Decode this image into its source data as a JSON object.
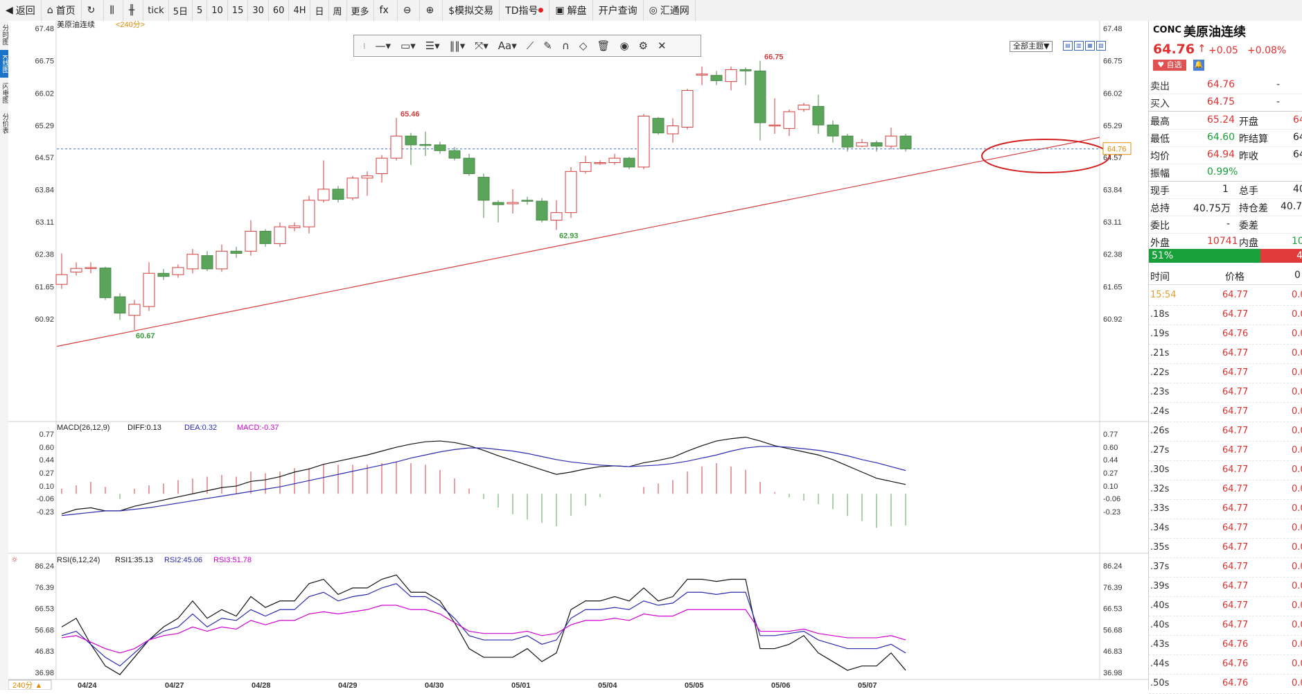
{
  "toolbar": {
    "items": [
      "返回",
      "首页",
      "",
      "",
      "",
      "tick",
      "5日",
      "5",
      "10",
      "15",
      "30",
      "60",
      "4H",
      "日",
      "周",
      "更多",
      "",
      "",
      "",
      "$模拟交易",
      "TD指号",
      "解盘",
      "开户查询",
      "汇通网"
    ]
  },
  "left_tabs": [
    "分时图",
    "K线图",
    "闪电图",
    "分价表"
  ],
  "chart": {
    "title": "美原油连续",
    "period": "<240分>",
    "theme_label": "全部主题▼",
    "period_button": "240分 ▲",
    "price_ticks": [
      "67.48",
      "66.75",
      "66.02",
      "65.29",
      "64.57",
      "63.84",
      "63.11",
      "62.38",
      "61.65",
      "60.92"
    ],
    "current_price_label": "64.76",
    "high_label": "66.75",
    "mid_high_label": "65.46",
    "low_label": "60.67",
    "mid_low_label": "62.93",
    "x_labels": [
      "04/24",
      "04/27",
      "04/28",
      "04/29",
      "04/30",
      "05/01",
      "05/04",
      "05/05",
      "05/06",
      "05/07"
    ],
    "macd": {
      "title": "MACD(26,12,9)",
      "diff": "DIFF:0.13",
      "dea": "DEA:0.32",
      "macd": "MACD:-0.37",
      "ticks": [
        "0.77",
        "0.60",
        "0.44",
        "0.27",
        "0.10",
        "-0.06",
        "-0.23"
      ]
    },
    "rsi": {
      "title": "RSI(6,12,24)",
      "rsi1": "RSI1:35.13",
      "rsi2": "RSI2:45.06",
      "rsi3": "RSI3:51.78",
      "ticks": [
        "86.24",
        "76.39",
        "66.53",
        "56.68",
        "46.83",
        "36.98"
      ]
    },
    "colors": {
      "up": "#d23c3c",
      "down": "#5aa55a",
      "diff": "#111111",
      "dea": "#2a2ab0",
      "macd": "#d000d0",
      "trend": "#d23c3c",
      "circle": "#d22020"
    }
  },
  "quote": {
    "code": "CONC",
    "name": "美原油连续",
    "price": "64.76",
    "arrow": "↑",
    "change": "+0.05",
    "change_pct": "+0.08%",
    "fav": "♥ 自选",
    "sell_label": "卖出",
    "sell": "64.76",
    "sell_vol": "-",
    "buy_label": "买入",
    "buy": "64.75",
    "buy_vol": "-",
    "high_label": "最高",
    "high": "65.24",
    "open_label": "开盘",
    "open": "64",
    "low_label": "最低",
    "low": "64.60",
    "prev_settle_label": "昨结算",
    "prev_settle": "64",
    "avg_label": "均价",
    "avg": "64.94",
    "prev_close_label": "昨收",
    "prev_close": "64",
    "amp_label": "振幅",
    "amp": "0.99%",
    "now_vol_label": "现手",
    "now_vol": "1",
    "total_vol_label": "总手",
    "total_vol": "40",
    "oi_label": "总持",
    "oi": "40.75万",
    "oi_diff_label": "持仓差",
    "oi_diff": "40.7",
    "ratio_label": "委比",
    "ratio": "-",
    "diff_label": "委差",
    "diff": "",
    "outer_label": "外盘",
    "outer": "10741",
    "inner_label": "内盘",
    "inner": "10",
    "buy_pct": "51%",
    "sell_pct": "4"
  },
  "ticks_table": {
    "headers": [
      "时间",
      "价格",
      "0"
    ],
    "rows": [
      {
        "t": "15:54",
        "p": "64.77",
        "v": "0.0"
      },
      {
        "t": ".18s",
        "p": "64.77",
        "v": "0.0"
      },
      {
        "t": ".19s",
        "p": "64.76",
        "v": "0.0"
      },
      {
        "t": ".21s",
        "p": "64.77",
        "v": "0.0"
      },
      {
        "t": ".22s",
        "p": "64.77",
        "v": "0.0"
      },
      {
        "t": ".23s",
        "p": "64.77",
        "v": "0.0"
      },
      {
        "t": ".24s",
        "p": "64.77",
        "v": "0.0"
      },
      {
        "t": ".26s",
        "p": "64.77",
        "v": "0.0"
      },
      {
        "t": ".27s",
        "p": "64.77",
        "v": "0.0"
      },
      {
        "t": ".30s",
        "p": "64.77",
        "v": "0.0"
      },
      {
        "t": ".32s",
        "p": "64.77",
        "v": "0.0"
      },
      {
        "t": ".33s",
        "p": "64.77",
        "v": "0.0"
      },
      {
        "t": ".34s",
        "p": "64.77",
        "v": "0.0"
      },
      {
        "t": ".35s",
        "p": "64.77",
        "v": "0.0"
      },
      {
        "t": ".37s",
        "p": "64.77",
        "v": "0.0"
      },
      {
        "t": ".39s",
        "p": "64.77",
        "v": "0.0"
      },
      {
        "t": ".40s",
        "p": "64.77",
        "v": "0.0"
      },
      {
        "t": ".40s",
        "p": "64.77",
        "v": "0.0"
      },
      {
        "t": ".43s",
        "p": "64.76",
        "v": "0.0"
      },
      {
        "t": ".44s",
        "p": "64.76",
        "v": "0.0"
      },
      {
        "t": ".50s",
        "p": "64.76",
        "v": "0.0"
      }
    ]
  },
  "candles": [
    {
      "o": 61.7,
      "c": 61.92,
      "h": 62.4,
      "l": 61.6
    },
    {
      "o": 61.98,
      "c": 62.06,
      "h": 62.2,
      "l": 61.9
    },
    {
      "o": 62.06,
      "c": 62.08,
      "h": 62.2,
      "l": 61.95
    },
    {
      "o": 62.07,
      "c": 61.4,
      "h": 62.1,
      "l": 61.35
    },
    {
      "o": 61.42,
      "c": 61.05,
      "h": 61.5,
      "l": 60.9
    },
    {
      "o": 61.0,
      "c": 61.25,
      "h": 61.35,
      "l": 60.67
    },
    {
      "o": 61.2,
      "c": 61.95,
      "h": 62.2,
      "l": 61.1
    },
    {
      "o": 61.95,
      "c": 61.88,
      "h": 62.05,
      "l": 61.8
    },
    {
      "o": 61.92,
      "c": 62.08,
      "h": 62.15,
      "l": 61.85
    },
    {
      "o": 62.05,
      "c": 62.38,
      "h": 62.5,
      "l": 61.95
    },
    {
      "o": 62.35,
      "c": 62.05,
      "h": 62.45,
      "l": 62.0
    },
    {
      "o": 62.05,
      "c": 62.45,
      "h": 62.6,
      "l": 61.98
    },
    {
      "o": 62.45,
      "c": 62.4,
      "h": 62.55,
      "l": 62.3
    },
    {
      "o": 62.45,
      "c": 62.9,
      "h": 63.15,
      "l": 62.35
    },
    {
      "o": 62.9,
      "c": 62.62,
      "h": 62.95,
      "l": 62.55
    },
    {
      "o": 62.62,
      "c": 63.0,
      "h": 63.1,
      "l": 62.55
    },
    {
      "o": 62.98,
      "c": 63.02,
      "h": 63.1,
      "l": 62.9
    },
    {
      "o": 63.0,
      "c": 63.6,
      "h": 63.7,
      "l": 62.85
    },
    {
      "o": 63.6,
      "c": 63.85,
      "h": 64.5,
      "l": 63.55
    },
    {
      "o": 63.85,
      "c": 63.62,
      "h": 63.92,
      "l": 63.55
    },
    {
      "o": 63.65,
      "c": 64.1,
      "h": 64.15,
      "l": 63.6
    },
    {
      "o": 64.1,
      "c": 64.15,
      "h": 64.25,
      "l": 63.7
    },
    {
      "o": 64.2,
      "c": 64.55,
      "h": 64.62,
      "l": 64.0
    },
    {
      "o": 64.55,
      "c": 65.05,
      "h": 65.46,
      "l": 64.5
    },
    {
      "o": 65.05,
      "c": 64.85,
      "h": 65.12,
      "l": 64.4
    },
    {
      "o": 64.86,
      "c": 64.85,
      "h": 65.15,
      "l": 64.6
    },
    {
      "o": 64.85,
      "c": 64.72,
      "h": 64.92,
      "l": 64.65
    },
    {
      "o": 64.72,
      "c": 64.55,
      "h": 64.8,
      "l": 64.5
    },
    {
      "o": 64.55,
      "c": 64.2,
      "h": 64.65,
      "l": 64.15
    },
    {
      "o": 64.12,
      "c": 63.6,
      "h": 64.2,
      "l": 63.2
    },
    {
      "o": 63.55,
      "c": 63.5,
      "h": 63.6,
      "l": 63.1
    },
    {
      "o": 63.52,
      "c": 63.55,
      "h": 63.85,
      "l": 63.3
    },
    {
      "o": 63.6,
      "c": 63.58,
      "h": 63.68,
      "l": 63.5
    },
    {
      "o": 63.58,
      "c": 63.15,
      "h": 63.65,
      "l": 63.1
    },
    {
      "o": 63.15,
      "c": 63.32,
      "h": 63.6,
      "l": 62.93
    },
    {
      "o": 63.32,
      "c": 64.25,
      "h": 64.35,
      "l": 63.2
    },
    {
      "o": 64.25,
      "c": 64.45,
      "h": 64.6,
      "l": 64.2
    },
    {
      "o": 64.45,
      "c": 64.45,
      "h": 64.5,
      "l": 64.4
    },
    {
      "o": 64.45,
      "c": 64.55,
      "h": 64.65,
      "l": 64.4
    },
    {
      "o": 64.55,
      "c": 64.35,
      "h": 64.58,
      "l": 64.3
    },
    {
      "o": 64.35,
      "c": 65.5,
      "h": 65.55,
      "l": 64.3
    },
    {
      "o": 65.45,
      "c": 65.12,
      "h": 65.48,
      "l": 65.08
    },
    {
      "o": 65.1,
      "c": 65.28,
      "h": 65.45,
      "l": 64.9
    },
    {
      "o": 65.25,
      "c": 66.08,
      "h": 66.12,
      "l": 65.2
    },
    {
      "o": 66.45,
      "c": 66.45,
      "h": 66.62,
      "l": 66.2
    },
    {
      "o": 66.42,
      "c": 66.3,
      "h": 66.52,
      "l": 66.2
    },
    {
      "o": 66.28,
      "c": 66.55,
      "h": 66.62,
      "l": 66.08
    },
    {
      "o": 66.55,
      "c": 66.52,
      "h": 66.6,
      "l": 66.2
    },
    {
      "o": 66.52,
      "c": 65.35,
      "h": 66.75,
      "l": 64.95
    },
    {
      "o": 65.3,
      "c": 65.3,
      "h": 65.9,
      "l": 65.1
    },
    {
      "o": 65.22,
      "c": 65.6,
      "h": 65.65,
      "l": 65.05
    },
    {
      "o": 65.65,
      "c": 65.75,
      "h": 65.8,
      "l": 65.6
    },
    {
      "o": 65.72,
      "c": 65.3,
      "h": 65.98,
      "l": 65.1
    },
    {
      "o": 65.3,
      "c": 65.05,
      "h": 65.4,
      "l": 64.9
    },
    {
      "o": 65.05,
      "c": 64.8,
      "h": 65.1,
      "l": 64.7
    },
    {
      "o": 64.82,
      "c": 64.9,
      "h": 64.98,
      "l": 64.8
    },
    {
      "o": 64.9,
      "c": 64.82,
      "h": 64.95,
      "l": 64.7
    },
    {
      "o": 64.82,
      "c": 65.05,
      "h": 65.24,
      "l": 64.75
    },
    {
      "o": 65.05,
      "c": 64.76,
      "h": 65.1,
      "l": 64.7
    }
  ],
  "macd_series": {
    "diff": [
      -0.26,
      -0.2,
      -0.18,
      -0.22,
      -0.22,
      -0.16,
      -0.12,
      -0.08,
      -0.04,
      0.0,
      0.04,
      0.08,
      0.1,
      0.16,
      0.18,
      0.22,
      0.28,
      0.32,
      0.38,
      0.42,
      0.46,
      0.5,
      0.55,
      0.6,
      0.64,
      0.67,
      0.68,
      0.66,
      0.62,
      0.56,
      0.49,
      0.43,
      0.37,
      0.31,
      0.25,
      0.28,
      0.32,
      0.35,
      0.36,
      0.35,
      0.4,
      0.43,
      0.47,
      0.55,
      0.62,
      0.68,
      0.71,
      0.73,
      0.68,
      0.62,
      0.58,
      0.54,
      0.5,
      0.44,
      0.36,
      0.28,
      0.2,
      0.16,
      0.12
    ],
    "dea": [
      -0.28,
      -0.26,
      -0.24,
      -0.22,
      -0.22,
      -0.2,
      -0.18,
      -0.15,
      -0.12,
      -0.09,
      -0.06,
      -0.03,
      0.0,
      0.03,
      0.06,
      0.09,
      0.13,
      0.17,
      0.21,
      0.25,
      0.29,
      0.33,
      0.37,
      0.41,
      0.46,
      0.5,
      0.54,
      0.57,
      0.59,
      0.59,
      0.57,
      0.55,
      0.52,
      0.48,
      0.44,
      0.41,
      0.39,
      0.37,
      0.36,
      0.35,
      0.36,
      0.37,
      0.39,
      0.42,
      0.46,
      0.5,
      0.55,
      0.59,
      0.61,
      0.61,
      0.6,
      0.58,
      0.56,
      0.53,
      0.49,
      0.44,
      0.4,
      0.35,
      0.3
    ],
    "macd": [
      0.06,
      0.1,
      0.14,
      0.08,
      -0.06,
      0.06,
      0.1,
      0.12,
      0.16,
      0.18,
      0.2,
      0.22,
      0.2,
      0.26,
      0.24,
      0.26,
      0.3,
      0.3,
      0.34,
      0.34,
      0.34,
      0.34,
      0.36,
      0.38,
      0.36,
      0.34,
      0.28,
      0.18,
      0.06,
      -0.06,
      -0.16,
      -0.24,
      -0.3,
      -0.34,
      -0.38,
      -0.26,
      -0.14,
      -0.04,
      0.0,
      0.0,
      0.08,
      0.12,
      0.16,
      0.26,
      0.32,
      0.36,
      0.32,
      0.28,
      0.14,
      0.02,
      -0.04,
      -0.08,
      -0.12,
      -0.18,
      -0.26,
      -0.32,
      -0.4,
      -0.38,
      -0.37
    ]
  },
  "rsi_series": {
    "rsi1": [
      58,
      62,
      50,
      40,
      36,
      44,
      52,
      58,
      62,
      70,
      62,
      66,
      63,
      72,
      67,
      70,
      70,
      78,
      80,
      73,
      76,
      76,
      80,
      82,
      74,
      74,
      70,
      60,
      48,
      44,
      44,
      44,
      48,
      42,
      46,
      66,
      70,
      70,
      72,
      70,
      76,
      70,
      72,
      80,
      80,
      79,
      80,
      80,
      48,
      48,
      50,
      54,
      46,
      42,
      38,
      40,
      40,
      46,
      38
    ],
    "rsi2": [
      54,
      56,
      50,
      44,
      40,
      46,
      52,
      56,
      58,
      64,
      58,
      62,
      61,
      66,
      63,
      66,
      66,
      72,
      74,
      70,
      72,
      73,
      76,
      78,
      72,
      72,
      68,
      62,
      54,
      52,
      52,
      52,
      54,
      50,
      52,
      62,
      66,
      66,
      67,
      66,
      70,
      68,
      69,
      74,
      74,
      73,
      74,
      74,
      54,
      54,
      55,
      56,
      52,
      50,
      48,
      48,
      48,
      50,
      46
    ],
    "rsi3": [
      53,
      54,
      51,
      48,
      46,
      48,
      52,
      54,
      55,
      58,
      56,
      58,
      57,
      61,
      59,
      61,
      61,
      64,
      65,
      64,
      65,
      66,
      68,
      68,
      66,
      66,
      64,
      60,
      56,
      55,
      55,
      55,
      56,
      54,
      55,
      59,
      61,
      61,
      62,
      61,
      64,
      63,
      63,
      66,
      66,
      66,
      66,
      66,
      56,
      56,
      56,
      57,
      55,
      54,
      53,
      53,
      53,
      54,
      52
    ]
  }
}
